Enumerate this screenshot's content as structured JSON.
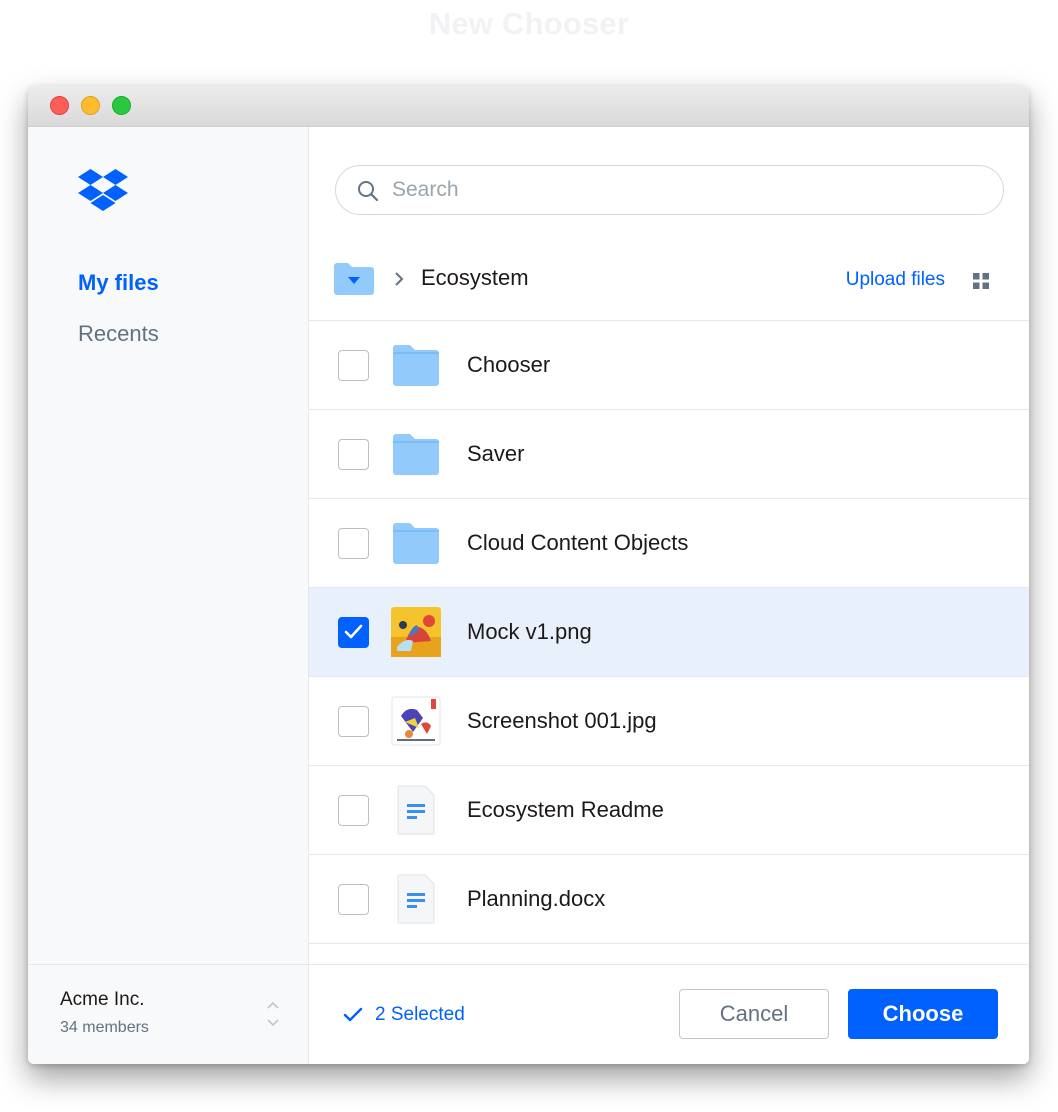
{
  "page_heading": "New Chooser",
  "sidebar": {
    "nav": [
      {
        "label": "My files",
        "active": true
      },
      {
        "label": "Recents",
        "active": false
      }
    ],
    "team": {
      "name": "Acme Inc.",
      "members": "34 members"
    }
  },
  "search": {
    "placeholder": "Search",
    "value": ""
  },
  "breadcrumb": {
    "current": "Ecosystem",
    "upload_label": "Upload files"
  },
  "files": [
    {
      "name": "Chooser",
      "type": "folder",
      "checked": false
    },
    {
      "name": "Saver",
      "type": "folder",
      "checked": false
    },
    {
      "name": "Cloud Content Objects",
      "type": "folder",
      "checked": false
    },
    {
      "name": "Mock v1.png",
      "type": "image",
      "checked": true
    },
    {
      "name": "Screenshot 001.jpg",
      "type": "image",
      "checked": false
    },
    {
      "name": "Ecosystem Readme",
      "type": "document",
      "checked": false
    },
    {
      "name": "Planning.docx",
      "type": "document",
      "checked": false
    }
  ],
  "footer": {
    "selected_label": "2 Selected",
    "cancel_label": "Cancel",
    "choose_label": "Choose"
  },
  "colors": {
    "accent": "#0061fe",
    "folder": "#92cbfb",
    "selected_row": "#e8f1fb"
  }
}
